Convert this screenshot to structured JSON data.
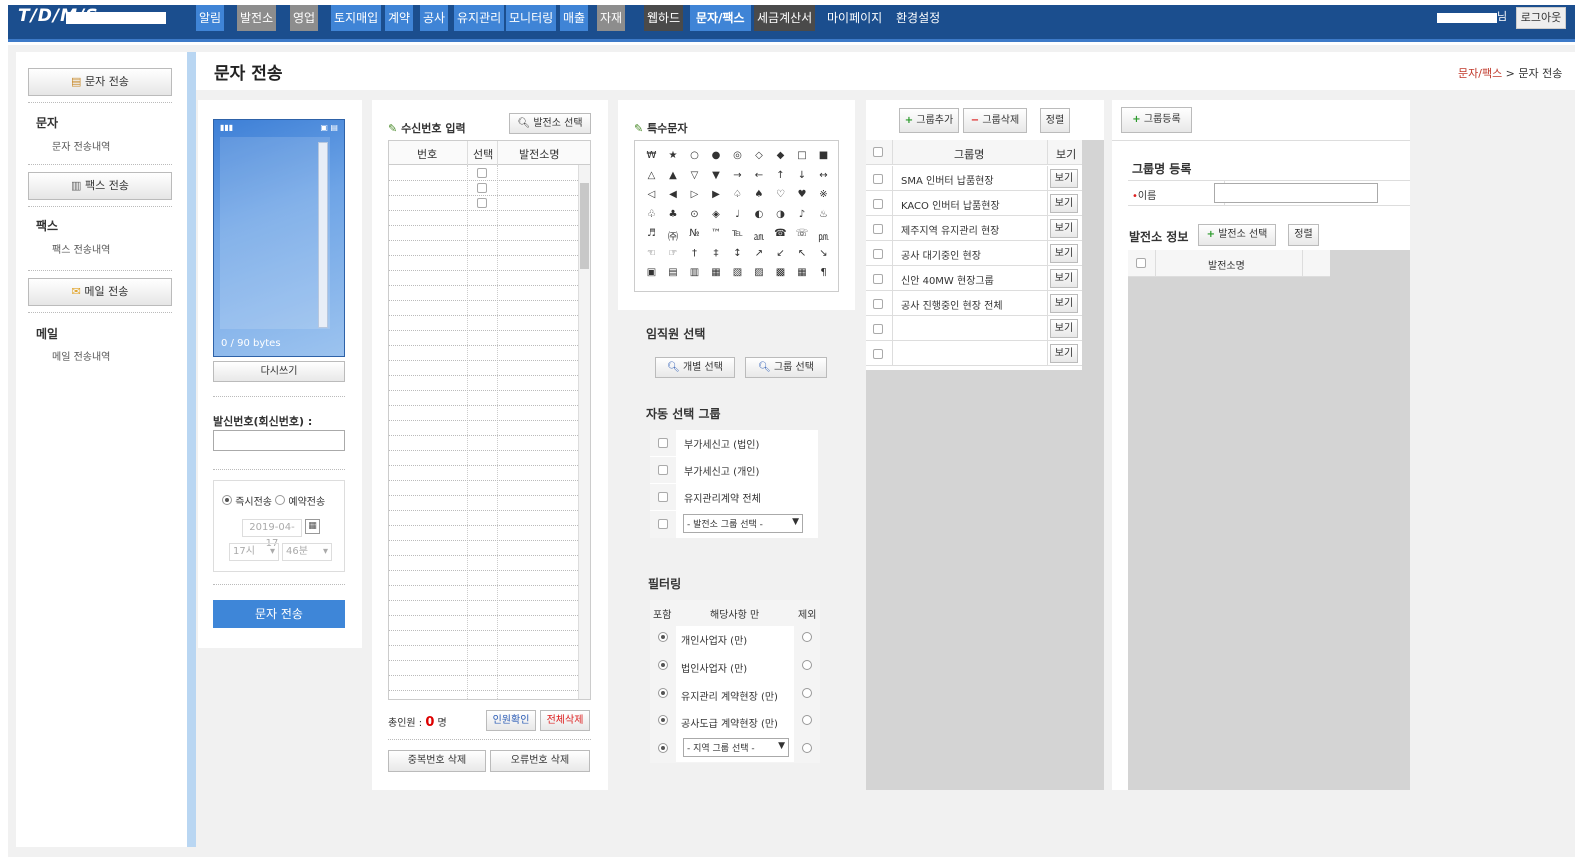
{
  "app": {
    "logo": "T/D/M/S",
    "user_suffix": "님",
    "logout": "로그아웃"
  },
  "nav": [
    "알림",
    "발전소",
    "영업",
    "토지매입",
    "계약",
    "공사",
    "유지관리",
    "모니터링",
    "매출",
    "자재",
    "웹하드",
    "문자/팩스",
    "세금계산서",
    "마이페이지",
    "환경설정"
  ],
  "sidebar": {
    "sms_btn": "문자 전송",
    "sms_head": "문자",
    "sms_hist": "문자 전송내역",
    "fax_btn": "팩스 전송",
    "fax_head": "팩스",
    "fax_hist": "팩스 전송내역",
    "mail_btn": "메일 전송",
    "mail_head": "메일",
    "mail_hist": "메일 전송내역"
  },
  "page": {
    "title": "문자 전송",
    "breadcrumb_section": "문자/팩스",
    "breadcrumb_sep": " > ",
    "breadcrumb_page": "문자 전송"
  },
  "composer": {
    "bytes": "0 / 90 bytes",
    "rewrite": "다시쓰기",
    "sender_label": "발신번호(회신번호) :",
    "sender_value": "",
    "send_now": "즉시전송",
    "send_reserve": "예약전송",
    "date": "2019-04-17",
    "hour": "17시",
    "minute": "46분",
    "send_btn": "문자 전송"
  },
  "recipients": {
    "title": "수신번호 입력",
    "station_btn": "발전소 선택",
    "cols": [
      "번호",
      "선택",
      "발전소명"
    ],
    "total_label": "총인원 : ",
    "total_count": "0",
    "total_unit": " 명",
    "confirm": "인원확인",
    "delete_all": "전체삭제",
    "dup_delete": "중복번호 삭제",
    "err_delete": "오류번호 삭제"
  },
  "special": {
    "title": "특수문자",
    "rows": [
      [
        "₩",
        "★",
        "○",
        "●",
        "◎",
        "◇",
        "◆",
        "□",
        "■"
      ],
      [
        "△",
        "▲",
        "▽",
        "▼",
        "→",
        "←",
        "↑",
        "↓",
        "↔"
      ],
      [
        "◁",
        "◀",
        "▷",
        "▶",
        "♤",
        "♠",
        "♡",
        "♥",
        "※"
      ],
      [
        "♧",
        "♣",
        "⊙",
        "◈",
        "♩",
        "◐",
        "◑",
        "♪",
        "♨"
      ],
      [
        "♬",
        "㈜",
        "№",
        "™",
        "℡",
        "㏂",
        "☎",
        "☏",
        "㏘"
      ],
      [
        "☜",
        "☞",
        "†",
        "‡",
        "↕",
        "↗",
        "↙",
        "↖",
        "↘"
      ],
      [
        "▣",
        "▤",
        "▥",
        "▦",
        "▧",
        "▨",
        "▩",
        "▦",
        "¶"
      ]
    ]
  },
  "staff": {
    "title": "임직원 선택",
    "individual": "개별 선택",
    "group": "그룹 선택"
  },
  "auto_group": {
    "title": "자동 선택 그룹",
    "items": [
      "부가세신고 (법인)",
      "부가세신고 (개인)",
      "유지관리계약 전체"
    ],
    "select": "- 발전소 그룹 선택 -"
  },
  "filter": {
    "title": "필터링",
    "col_include": "포함",
    "col_item": "해당사항 만",
    "col_exclude": "제외",
    "items": [
      "개인사업자 (만)",
      "법인사업자 (만)",
      "유지관리 계약현장 (만)",
      "공사도급 계약현장 (만)"
    ],
    "region_select": "- 지역 그룹 선택 -"
  },
  "groups": {
    "add": "그룹추가",
    "delete": "그룹삭제",
    "sort": "정렬",
    "col_name": "그룹명",
    "col_view": "보기",
    "view": "보기",
    "rows": [
      "SMA 인버터 납품현장",
      "KACO 인버터 납품현장",
      "제주지역 유지관리 현장",
      "공사 대기중인 현장",
      "신안 40MW 현장그룹",
      "공사 진행중인 현장 전체",
      "",
      ""
    ]
  },
  "group_reg": {
    "register_btn": "그룹등록",
    "title": "그룹명 등록",
    "name_label": "이름",
    "name_value": "",
    "station_info": "발전소 정보",
    "station_select": "발전소 선택",
    "sort": "정렬",
    "col_station": "발전소명"
  },
  "icons": [
    "phone-signal-icon",
    "phone-battery-icon",
    "calendar-icon",
    "search-icon",
    "plus-icon",
    "minus-icon",
    "pencil-icon",
    "mail-icon",
    "document-icon",
    "fax-icon"
  ]
}
